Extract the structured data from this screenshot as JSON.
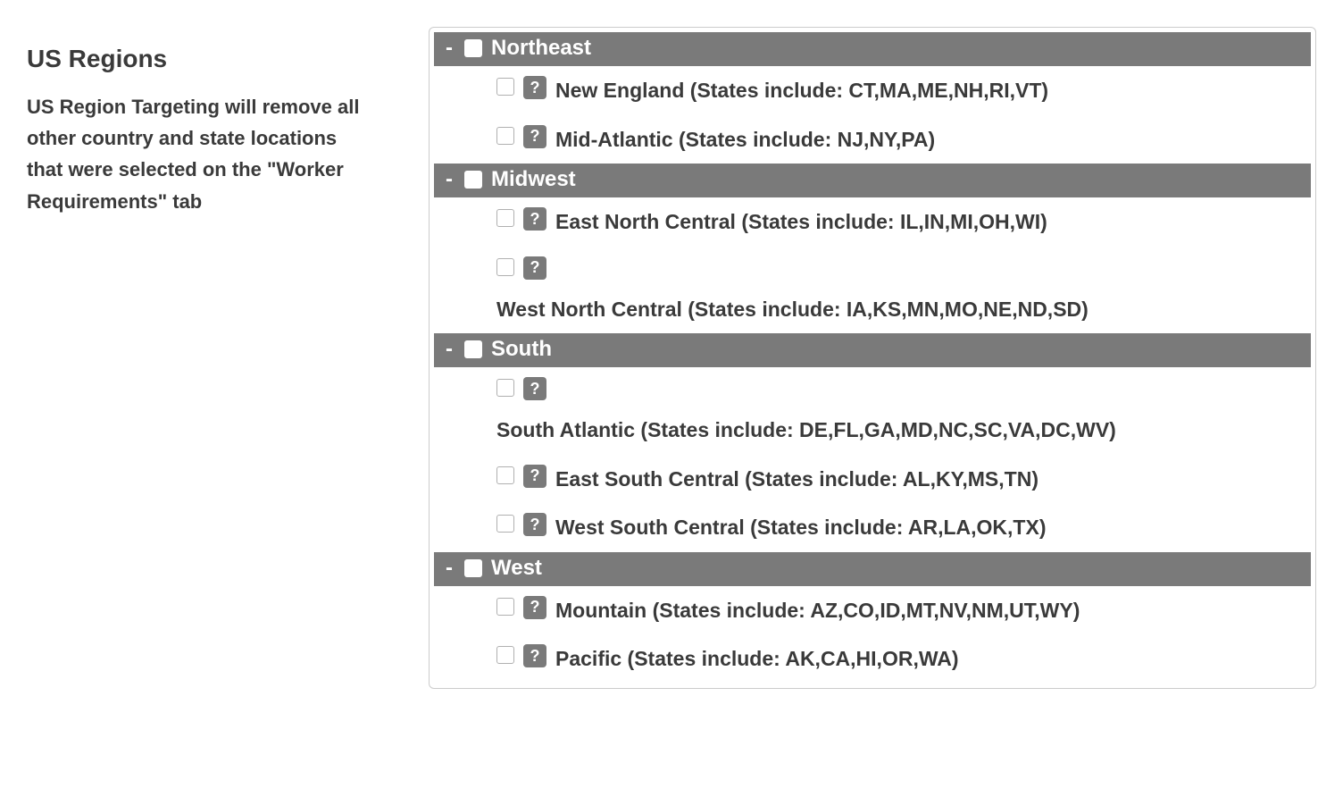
{
  "sidebar": {
    "title": "US Regions",
    "description": "US Region Targeting will remove all other country and state locations that were selected on the \"Worker Requirements\" tab"
  },
  "collapse_glyph": "-",
  "help_glyph": "?",
  "regions": [
    {
      "name": "Northeast",
      "subregions": [
        {
          "label": "New England (States include: CT,MA,ME,NH,RI,VT)",
          "wrap": false
        },
        {
          "label": "Mid-Atlantic (States include: NJ,NY,PA)",
          "wrap": false
        }
      ]
    },
    {
      "name": "Midwest",
      "subregions": [
        {
          "label": "East North Central (States include: IL,IN,MI,OH,WI)",
          "wrap": false
        },
        {
          "label": "West North Central (States include: IA,KS,MN,MO,NE,ND,SD)",
          "wrap": true
        }
      ]
    },
    {
      "name": "South",
      "subregions": [
        {
          "label": "South Atlantic (States include: DE,FL,GA,MD,NC,SC,VA,DC,WV)",
          "wrap": true
        },
        {
          "label": "East South Central (States include: AL,KY,MS,TN)",
          "wrap": false
        },
        {
          "label": "West South Central (States include: AR,LA,OK,TX)",
          "wrap": false
        }
      ]
    },
    {
      "name": "West",
      "subregions": [
        {
          "label": "Mountain (States include: AZ,CO,ID,MT,NV,NM,UT,WY)",
          "wrap": false
        },
        {
          "label": "Pacific (States include: AK,CA,HI,OR,WA)",
          "wrap": false
        }
      ]
    }
  ]
}
